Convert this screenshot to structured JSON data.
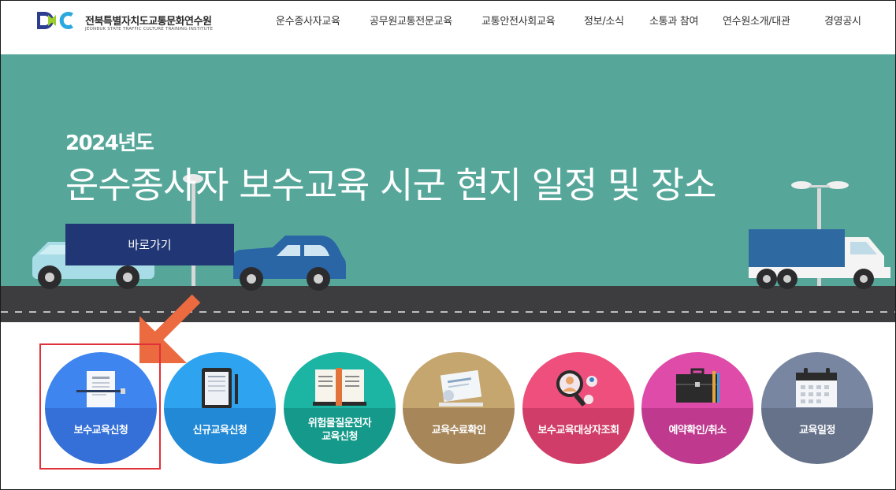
{
  "header": {
    "logo_kr": "전북특별자치도교통문화연수원",
    "logo_en": "JEONBUK STATE TRAFFIC CULTURE TRAINING INSTITUTE",
    "nav": [
      {
        "label": "운수종사자교육"
      },
      {
        "label": "공무원교통전문교육"
      },
      {
        "label": "교통안전사회교육"
      },
      {
        "label": "정보/소식"
      },
      {
        "label": "소통과 참여"
      },
      {
        "label": "연수원소개/대관"
      },
      {
        "label": "경영공시"
      }
    ]
  },
  "banner": {
    "year": "2024년도",
    "headline": "운수종사자 보수교육 시군 현지 일정 및 장소",
    "button": "바로가기"
  },
  "menu": [
    {
      "label": "보수교육신청",
      "icon": "document-pen-icon",
      "color_top": "#3f85f0",
      "color_bottom": "#3470d8"
    },
    {
      "label": "신규교육신청",
      "icon": "tablet-pen-icon",
      "color_top": "#2ea3f0",
      "color_bottom": "#2289d6"
    },
    {
      "label": "위험물질운전자\n교육신청",
      "icon": "open-book-icon",
      "color_top": "#1cb4a3",
      "color_bottom": "#14998a"
    },
    {
      "label": "교육수료확인",
      "icon": "certificate-icon",
      "color_top": "#c6a66f",
      "color_bottom": "#a7865a"
    },
    {
      "label": "보수교육대상자조회",
      "icon": "magnifier-person-icon",
      "color_top": "#ee4f7c",
      "color_bottom": "#d03d68"
    },
    {
      "label": "예약확인/취소",
      "icon": "briefcase-icon",
      "color_top": "#df4ba8",
      "color_bottom": "#bf3a8f"
    },
    {
      "label": "교육일정",
      "icon": "calendar-icon",
      "color_top": "#7886a1",
      "color_bottom": "#66728a"
    }
  ]
}
